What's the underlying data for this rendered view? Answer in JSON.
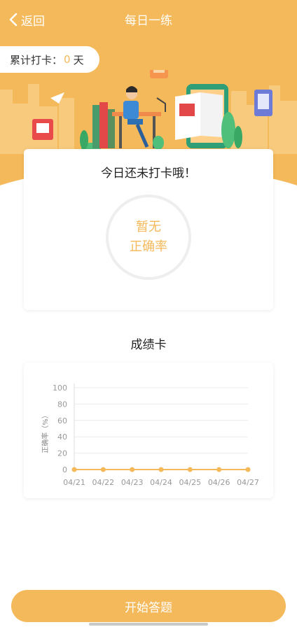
{
  "nav": {
    "back_label": "返回",
    "title": "每日一练"
  },
  "checkin": {
    "label": "累计打卡：",
    "days": "0",
    "unit": "天"
  },
  "today_card": {
    "message": "今日还未打卡哦！",
    "accuracy_line1": "暂无",
    "accuracy_line2": "正确率"
  },
  "score_section": {
    "title": "成绩卡"
  },
  "chart_data": {
    "type": "line",
    "x": [
      "04/21",
      "04/22",
      "04/23",
      "04/24",
      "04/25",
      "04/26",
      "04/27"
    ],
    "series": [
      {
        "values": [
          0,
          0,
          0,
          0,
          0,
          0,
          0
        ]
      }
    ],
    "ylabel": "正确率（%）",
    "ylim": [
      0,
      100
    ],
    "yticks": [
      0,
      20,
      40,
      60,
      80,
      100
    ],
    "grid": true,
    "color": "#f4b95a"
  },
  "footer": {
    "start_label": "开始答题"
  },
  "colors": {
    "accent": "#f4b95a"
  }
}
